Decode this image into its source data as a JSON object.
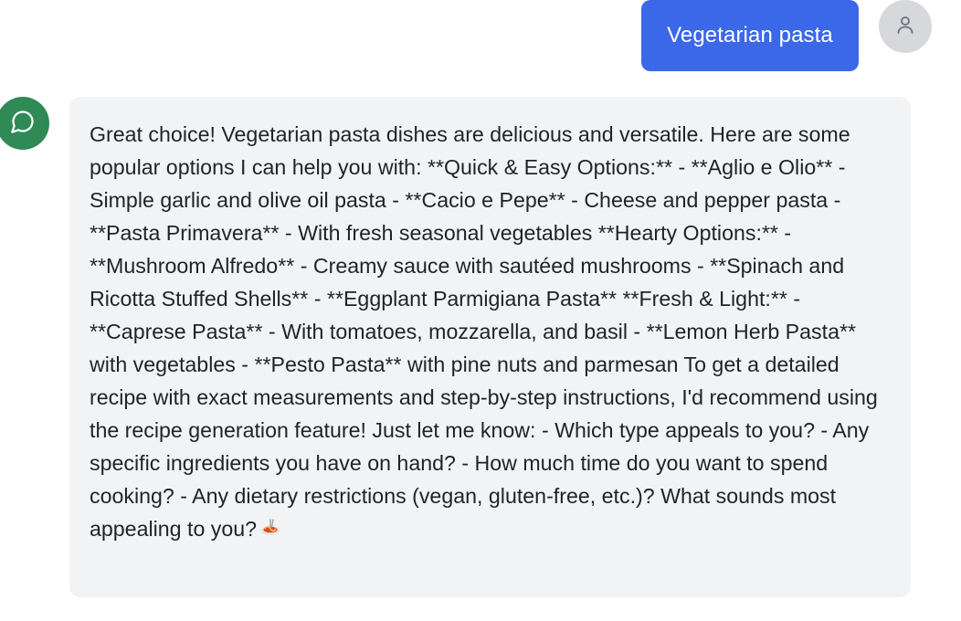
{
  "conversation": {
    "user_message": "Vegetarian pasta",
    "assistant_message": "Great choice! Vegetarian pasta dishes are delicious and versatile. Here are some popular options I can help you with: **Quick & Easy Options:** - **Aglio e Olio** - Simple garlic and olive oil pasta - **Cacio e Pepe** - Cheese and pepper pasta - **Pasta Primavera** - With fresh seasonal vegetables **Hearty Options:** - **Mushroom Alfredo** - Creamy sauce with sautéed mushrooms - **Spinach and Ricotta Stuffed Shells** - **Eggplant Parmigiana Pasta** **Fresh & Light:** - **Caprese Pasta** - With tomatoes, mozzarella, and basil - **Lemon Herb Pasta** with vegetables - **Pesto Pasta** with pine nuts and parmesan To get a detailed recipe with exact measurements and step-by-step instructions, I'd recommend using the recipe generation feature! Just let me know: - Which type appeals to you? - Any specific ingredients you have on hand? - How much time do you want to spend cooking? - Any dietary restrictions (vegan, gluten-free, etc.)? What sounds most appealing to you?",
    "assistant_emoji_icon": "pasta-plate-icon"
  },
  "icons": {
    "user_avatar": "user-icon",
    "assistant_avatar": "chat-bubble-icon"
  },
  "colors": {
    "user_bubble": "#3b68e8",
    "assistant_bubble": "#f2f3f5",
    "assistant_avatar": "#2f8a55",
    "user_avatar": "#d6d8dc"
  }
}
